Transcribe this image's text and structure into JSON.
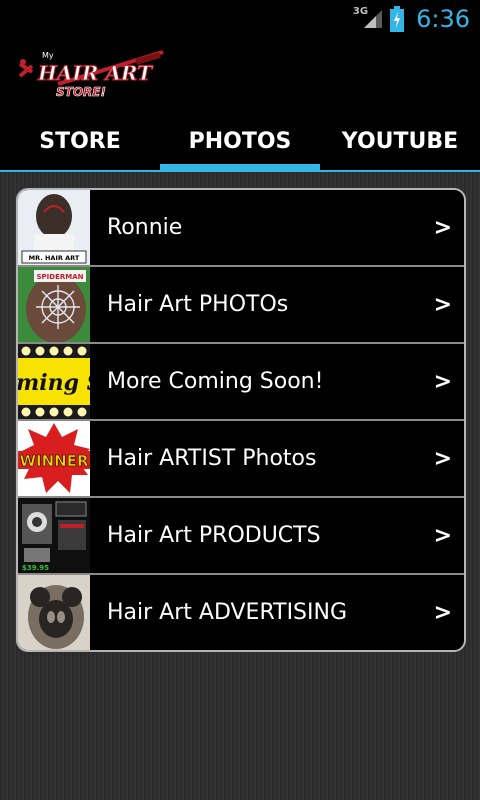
{
  "status_bar": {
    "network": "3G",
    "time": "6:36"
  },
  "app": {
    "logo_text_top": "HAIR ART",
    "logo_text_bottom": "STORE!",
    "logo_text_small": "My"
  },
  "tabs": [
    {
      "label": "STORE",
      "active": false
    },
    {
      "label": "PHOTOS",
      "active": true
    },
    {
      "label": "YOUTUBE",
      "active": false
    }
  ],
  "list": {
    "chevron": ">",
    "items": [
      {
        "label": "Ronnie",
        "thumb_caption": "MR. HAIR ART"
      },
      {
        "label": "Hair Art PHOTOs",
        "thumb_caption": "SPIDERMAN"
      },
      {
        "label": "More Coming Soon!",
        "thumb_caption": "ming Soo"
      },
      {
        "label": "Hair ARTIST Photos",
        "thumb_caption": "WINNER"
      },
      {
        "label": "Hair Art PRODUCTS",
        "thumb_caption": "$39.95"
      },
      {
        "label": "Hair Art ADVERTISING",
        "thumb_caption": ""
      }
    ]
  },
  "colors": {
    "accent": "#33b5e5",
    "background": "#000000",
    "content_bg": "#2e2e2e",
    "list_border": "#b5b5b5"
  }
}
